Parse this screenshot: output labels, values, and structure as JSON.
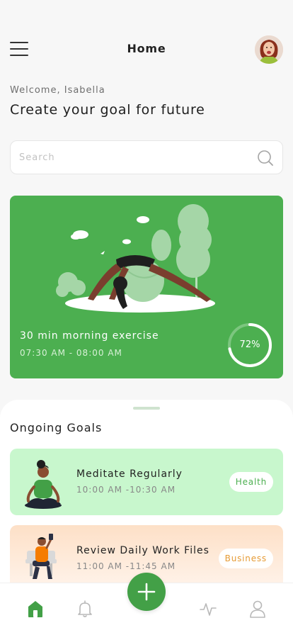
{
  "header": {
    "title": "Home"
  },
  "welcome": "Welcome, Isabella",
  "headline": "Create your goal for future",
  "search": {
    "placeholder": "Search"
  },
  "featured": {
    "title": "30 min morning exercise",
    "time": "07:30 AM - 08:00 AM",
    "progress": 72,
    "progress_label": "72%"
  },
  "ongoing": {
    "title": "Ongoing Goals",
    "items": [
      {
        "name": "Meditate Regularly",
        "time": "10:00 AM -10:30 AM",
        "tag": "Health"
      },
      {
        "name": "Review Daily Work Files",
        "time": "11:00 AM -11:45 AM",
        "tag": "Business"
      }
    ]
  },
  "colors": {
    "accent": "#4caf50",
    "health_card": "#c8f7cd",
    "business_card": "#fde0c7",
    "business_tag": "#e69b35"
  },
  "nav": {
    "items": [
      "home-icon",
      "bell-icon",
      "plus-icon",
      "activity-icon",
      "profile-icon"
    ],
    "active": "home-icon"
  }
}
